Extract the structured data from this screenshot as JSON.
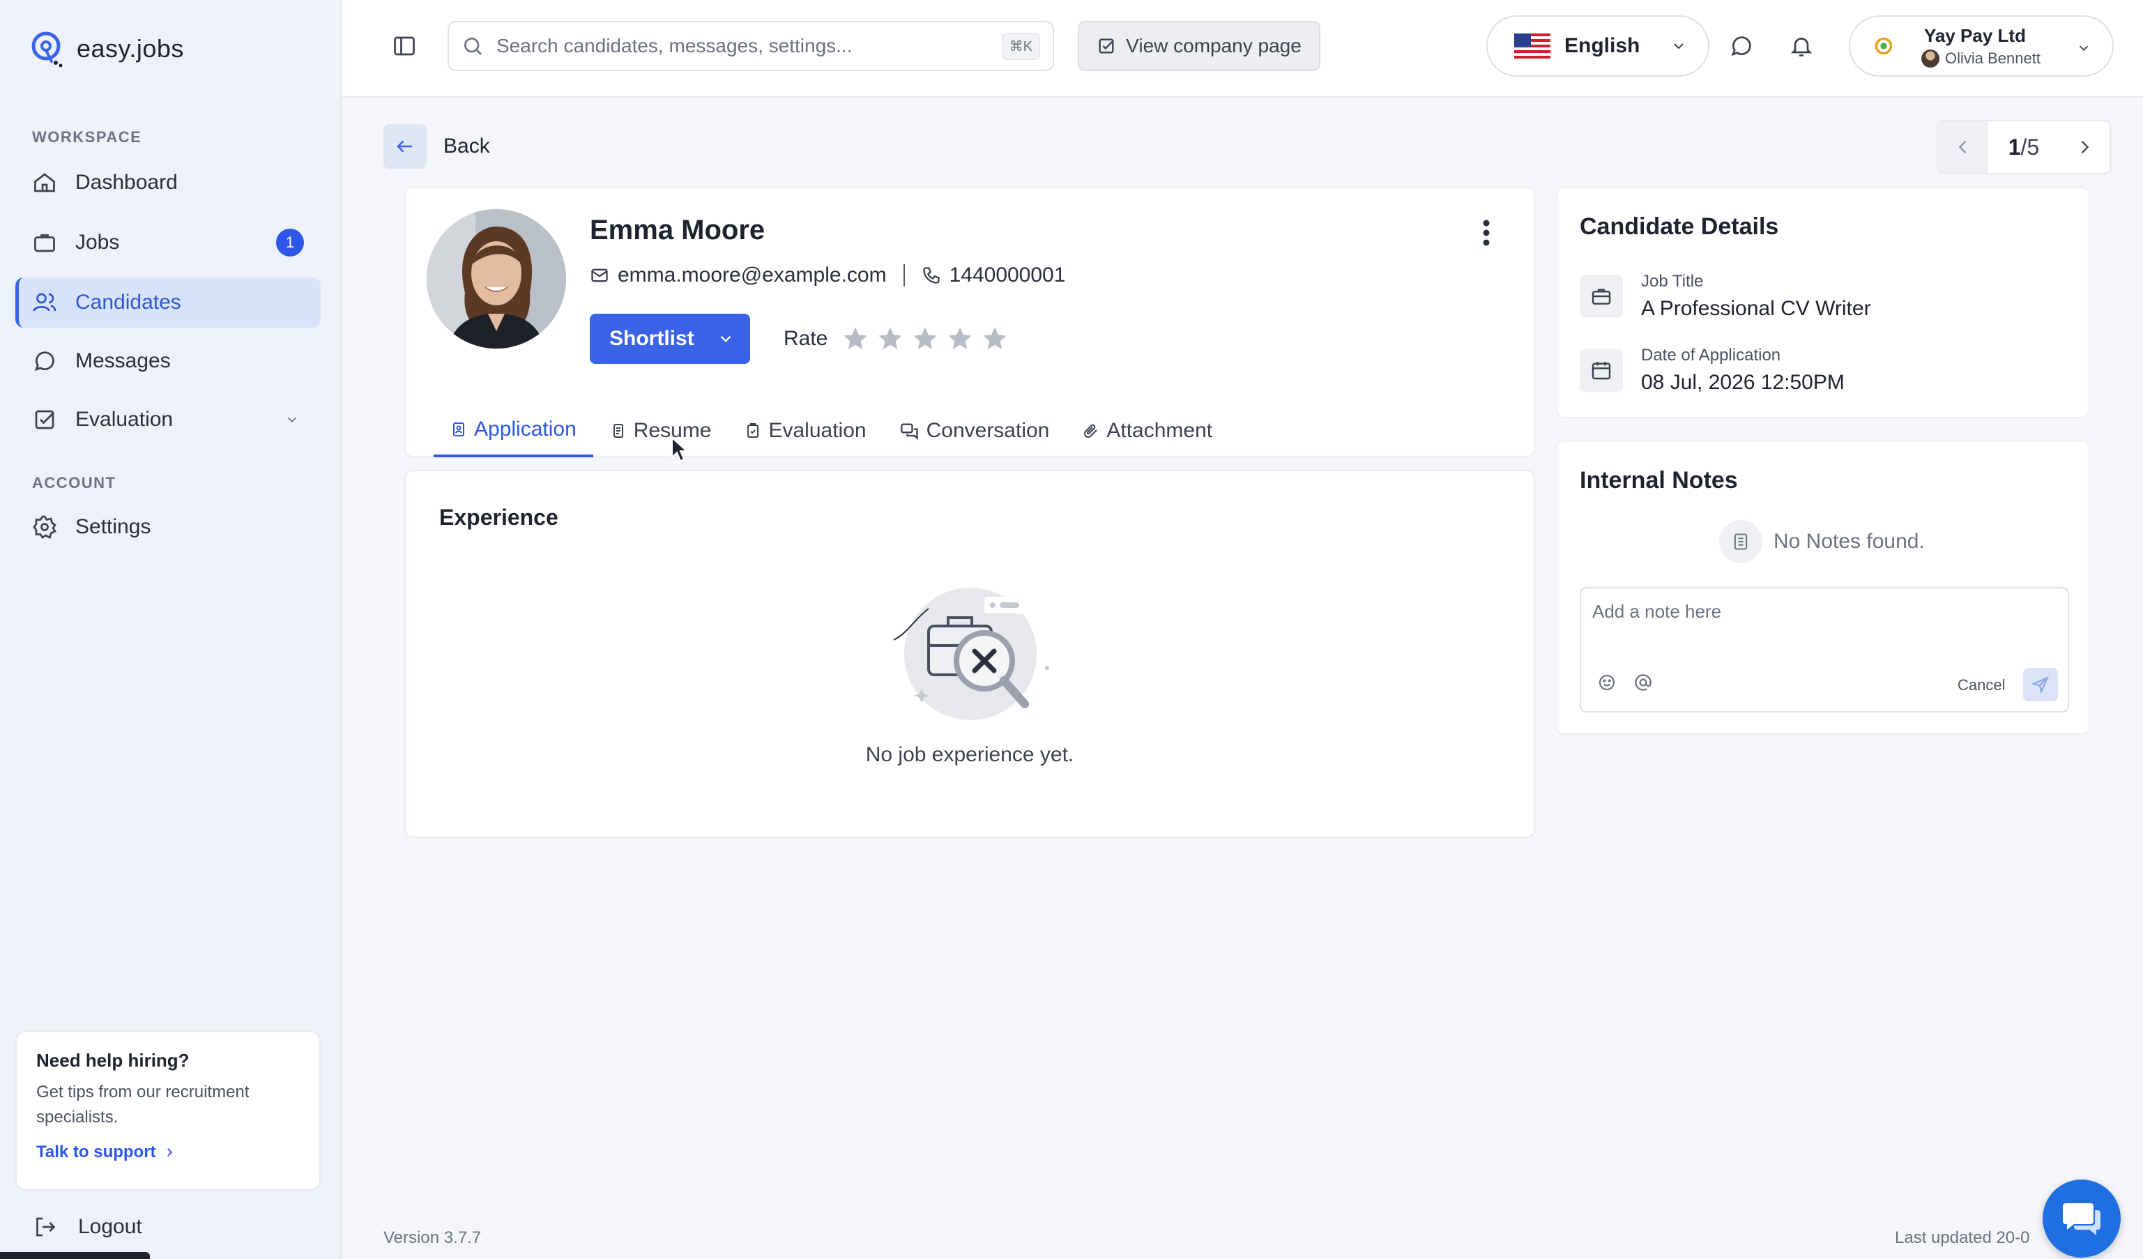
{
  "app": {
    "name": "easy.jobs"
  },
  "sidebar": {
    "workspace_label": "WORKSPACE",
    "account_label": "ACCOUNT",
    "items": [
      {
        "label": "Dashboard",
        "icon": "home-icon"
      },
      {
        "label": "Jobs",
        "icon": "briefcase-icon",
        "badge": "1"
      },
      {
        "label": "Candidates",
        "icon": "users-icon",
        "active": true
      },
      {
        "label": "Messages",
        "icon": "chat-icon"
      },
      {
        "label": "Evaluation",
        "icon": "checklist-icon"
      },
      {
        "label": "Settings",
        "icon": "gear-icon"
      }
    ],
    "help": {
      "title": "Need help hiring?",
      "text": "Get tips from our recruitment specialists.",
      "link": "Talk to support"
    },
    "logout": "Logout"
  },
  "topbar": {
    "search_placeholder": "Search candidates, messages, settings...",
    "search_shortcut": "⌘K",
    "company_page": "View company page",
    "language": "English",
    "account": {
      "company": "Yay Pay Ltd",
      "user": "Olivia Bennett"
    }
  },
  "nav": {
    "back": "Back",
    "pager_current": "1",
    "pager_total": "/5"
  },
  "candidate": {
    "name": "Emma Moore",
    "email": "emma.moore@example.com",
    "phone": "1440000001",
    "status": "Shortlist",
    "rate_label": "Rate",
    "rating": 0,
    "rating_max": 5
  },
  "tabs": [
    {
      "label": "Application",
      "active": true
    },
    {
      "label": "Resume"
    },
    {
      "label": "Evaluation"
    },
    {
      "label": "Conversation"
    },
    {
      "label": "Attachment"
    }
  ],
  "experience": {
    "title": "Experience",
    "empty": "No job experience yet."
  },
  "details": {
    "title": "Candidate Details",
    "job_title_label": "Job Title",
    "job_title": "A Professional CV Writer",
    "date_label": "Date of Application",
    "date": "08 Jul, 2026 12:50PM"
  },
  "notes": {
    "title": "Internal Notes",
    "empty": "No Notes found.",
    "placeholder": "Add a note here",
    "cancel": "Cancel"
  },
  "footer": {
    "version": "Version 3.7.7",
    "updated": "Last updated 20-0"
  },
  "colors": {
    "primary": "#3a63e8",
    "sidebar_bg": "#eef2f8",
    "active_bg": "#d8e3fb"
  }
}
